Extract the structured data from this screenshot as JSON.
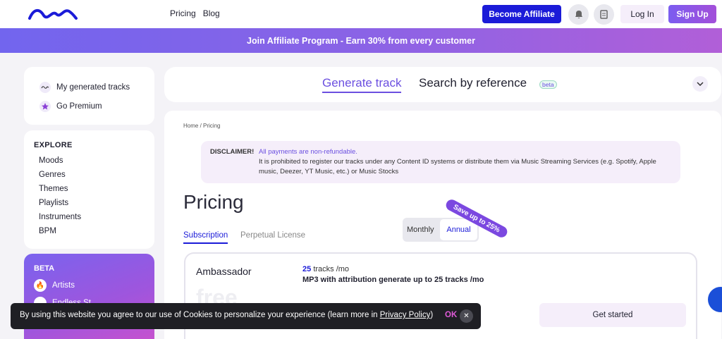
{
  "header": {
    "nav": [
      "Pricing",
      "Blog"
    ],
    "affiliate_label": "Become Affiliate",
    "login_label": "Log In",
    "signup_label": "Sign Up",
    "icons": [
      "logo-wave-icon",
      "bell-icon",
      "document-icon"
    ]
  },
  "banner": {
    "text": "Join Affiliate Program - Earn 30% from every customer"
  },
  "sidebar": {
    "top_items": [
      {
        "label": "My generated tracks",
        "icon": "wave-icon"
      },
      {
        "label": "Go Premium",
        "icon": "star-icon"
      }
    ],
    "explore_title": "EXPLORE",
    "explore_items": [
      "Moods",
      "Genres",
      "Themes",
      "Playlists",
      "Instruments",
      "BPM"
    ],
    "beta_title": "BETA",
    "beta_items": [
      {
        "label": "Artists",
        "icon": "fire-icon"
      },
      {
        "label": "Endless St...",
        "icon": "circle-icon"
      }
    ]
  },
  "generate": {
    "active_tab": "Generate track",
    "other_tab": "Search by reference",
    "beta_badge": "beta"
  },
  "main": {
    "breadcrumb": "Home  /  Pricing",
    "disclaimer": {
      "label": "DISCLAIMER!",
      "highlight": "All payments are non-refundable.",
      "text": "It is prohibited to register our tracks under any Content ID systems or distribute them via Music Streaming Services (e.g. Spotify, Apple music, Deezer, YT Music, etc.) or Music Stocks"
    },
    "title": "Pricing",
    "tabs": [
      "Subscription",
      "Perpetual License"
    ],
    "toggle": {
      "monthly": "Monthly",
      "annual": "Annual",
      "selected": "Annual"
    },
    "save_badge": "Save up to 25%",
    "plan": {
      "name": "Ambassador",
      "tracks_count": "25",
      "tracks_unit": "tracks /mo",
      "description": "MP3 with attribution generate up to 25 tracks /mo",
      "price": "free",
      "cta": "Get started"
    }
  },
  "cookie": {
    "text": "By using this website you agree to our use of Cookies to personalize your experience (learn more in ",
    "link": "Privacy Policy",
    "text_end": ")",
    "ok": "OK",
    "close_icon": "close-icon"
  },
  "colors": {
    "accent": "#1b1bd8",
    "purple": "#6b4fe0",
    "banner_start": "#7265ee",
    "banner_end": "#b15fd8"
  }
}
